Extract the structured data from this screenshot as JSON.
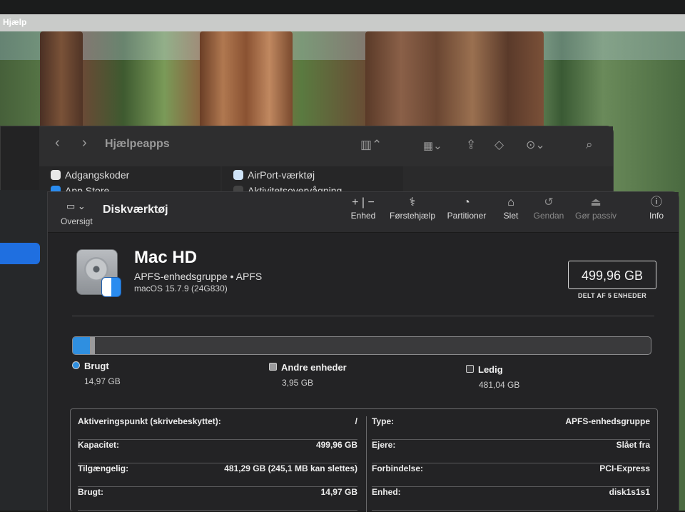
{
  "menubar": {
    "help_label": "Hjælp"
  },
  "finder": {
    "title": "Hjælpeapps",
    "items_col1": [
      "Adgangskoder",
      "App Store"
    ],
    "items_col2": [
      "AirPort-værktøj",
      "Aktivitetsovervågning"
    ]
  },
  "du": {
    "title": "Diskværktøj",
    "sidebar_label": "Oversigt",
    "toolbar": {
      "enhed": "Enhed",
      "forstehjaelp": "Førstehjælp",
      "partitioner": "Partitioner",
      "slet": "Slet",
      "gendan": "Gendan",
      "gor_passiv": "Gør passiv",
      "info": "Info"
    },
    "volume": {
      "name": "Mac HD",
      "subtitle": "APFS-enhedsgruppe • APFS",
      "os": "macOS 15.7.9 (24G830)",
      "capacity": "499,96 GB",
      "capacity_sub": "DELT AF 5 ENHEDER"
    },
    "usage": {
      "used_label": "Brugt",
      "used_value": "14,97 GB",
      "used_fraction": 0.03,
      "other_label": "Andre enheder",
      "other_value": "3,95 GB",
      "other_fraction": 0.008,
      "free_label": "Ledig",
      "free_value": "481,04 GB",
      "colors": {
        "used": "#2f8fe0",
        "other": "#9a9a9c",
        "free": "#3a3a3c"
      }
    },
    "info_left": [
      {
        "k": "Aktiveringspunkt (skrivebeskyttet):",
        "v": "/"
      },
      {
        "k": "Kapacitet:",
        "v": "499,96 GB"
      },
      {
        "k": "Tilgængelig:",
        "v": "481,29 GB (245,1 MB kan slettes)"
      },
      {
        "k": "Brugt:",
        "v": "14,97 GB"
      }
    ],
    "info_right": [
      {
        "k": "Type:",
        "v": "APFS-enhedsgruppe"
      },
      {
        "k": "Ejere:",
        "v": "Slået fra"
      },
      {
        "k": "Forbindelse:",
        "v": "PCI-Express"
      },
      {
        "k": "Enhed:",
        "v": "disk1s1s1"
      }
    ]
  }
}
